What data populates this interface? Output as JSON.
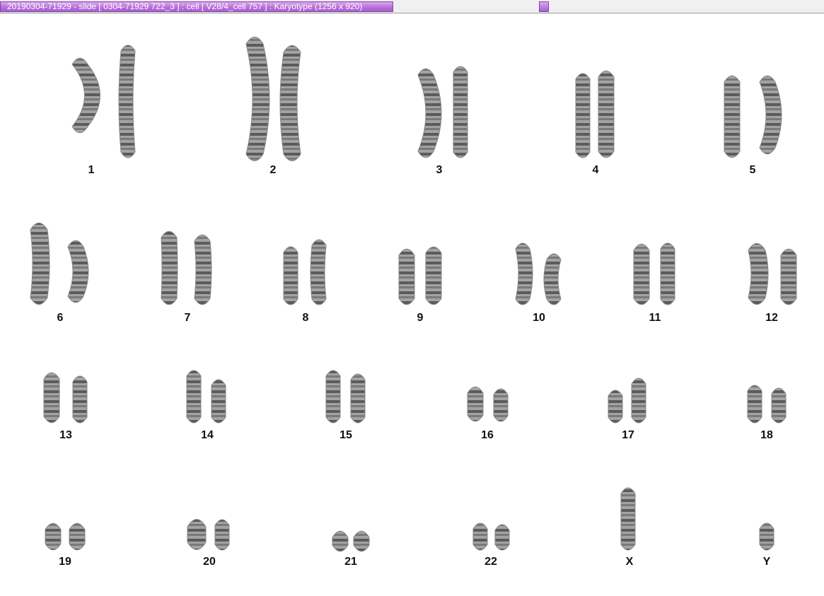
{
  "window": {
    "title": "20190304-71929 - slide [ 0304-71929 722_3 ] : cell [ V28/4_cell 757 ] : Karyotype  (1256 x 920)"
  },
  "karyotype": {
    "labels": {
      "c1": "1",
      "c2": "2",
      "c3": "3",
      "c4": "4",
      "c5": "5",
      "c6": "6",
      "c7": "7",
      "c8": "8",
      "c9": "9",
      "c10": "10",
      "c11": "11",
      "c12": "12",
      "c13": "13",
      "c14": "14",
      "c15": "15",
      "c16": "16",
      "c17": "17",
      "c18": "18",
      "c19": "19",
      "c20": "20",
      "c21": "21",
      "c22": "22",
      "cX": "X",
      "cY": "Y"
    }
  }
}
